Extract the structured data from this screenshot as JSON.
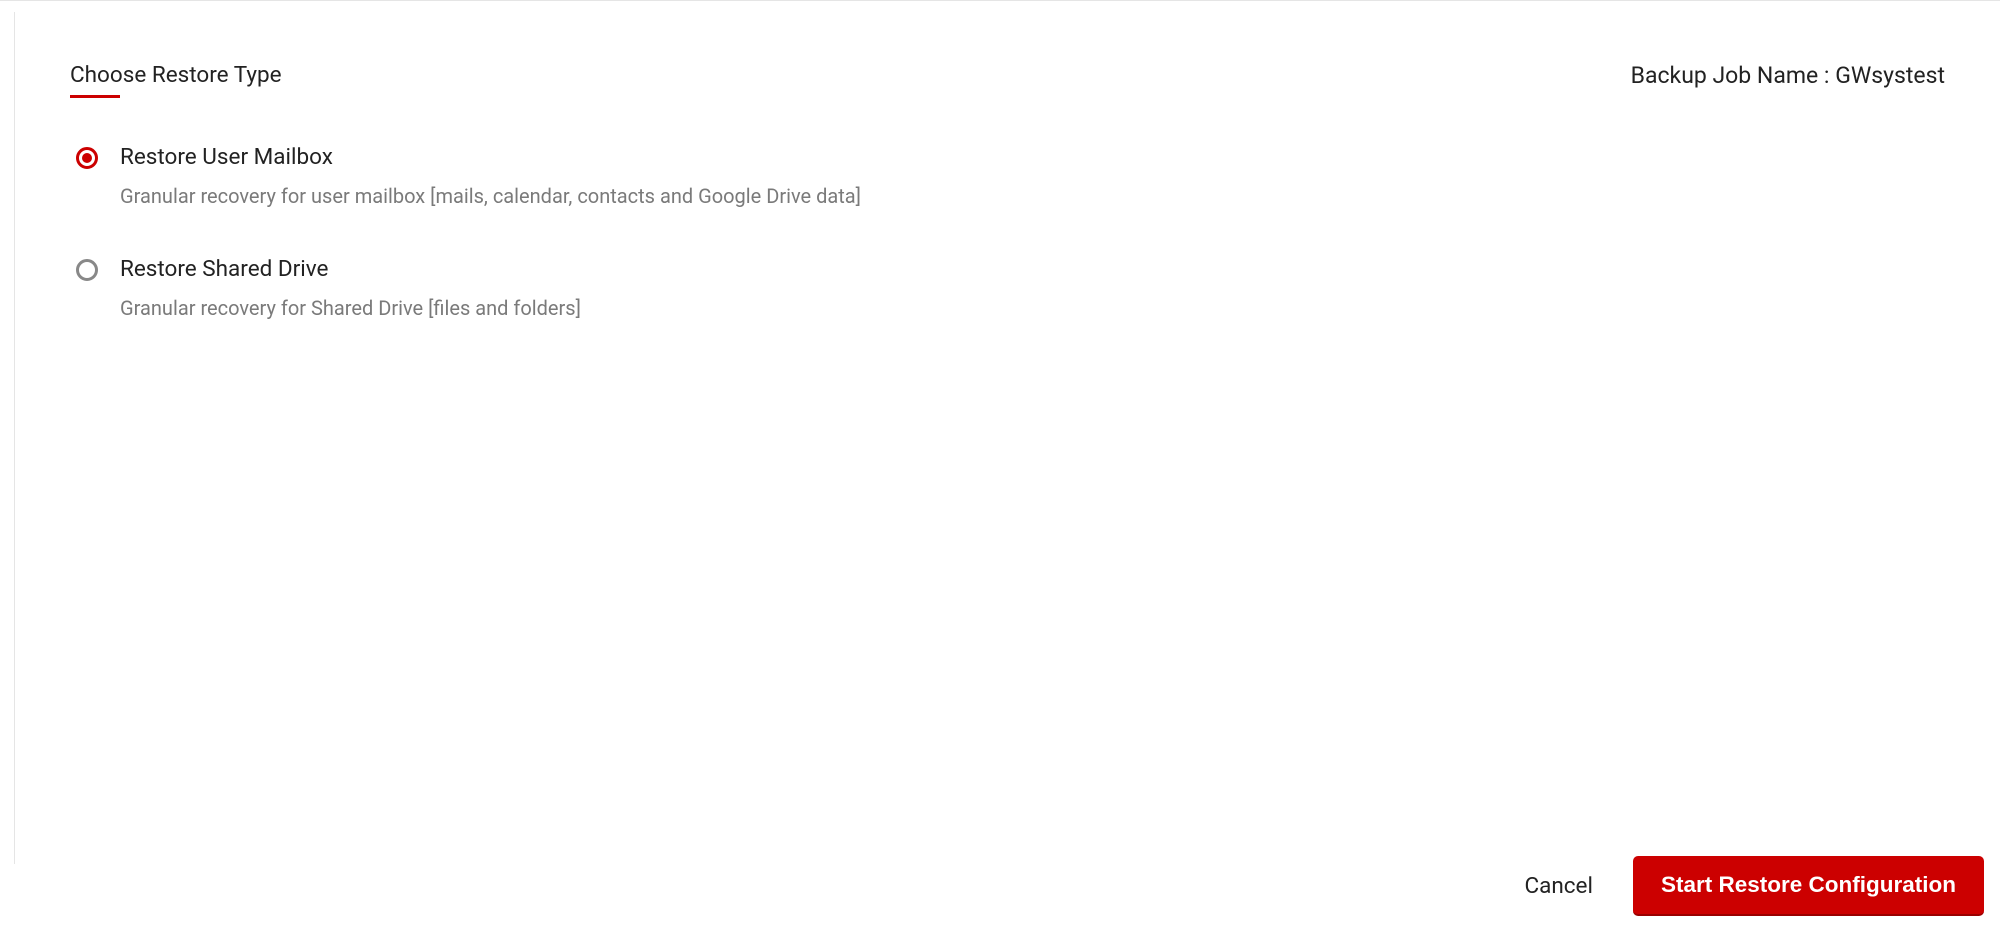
{
  "header": {
    "section_title": "Choose Restore Type",
    "job_label": "Backup Job Name : ",
    "job_value": "GWsystest"
  },
  "options": [
    {
      "title": "Restore User Mailbox",
      "desc": "Granular recovery for user mailbox [mails, calendar, contacts and Google Drive data]",
      "selected": true
    },
    {
      "title": "Restore Shared Drive",
      "desc": "Granular recovery for Shared Drive [files and folders]",
      "selected": false
    }
  ],
  "footer": {
    "cancel_label": "Cancel",
    "primary_label": "Start Restore Configuration"
  }
}
